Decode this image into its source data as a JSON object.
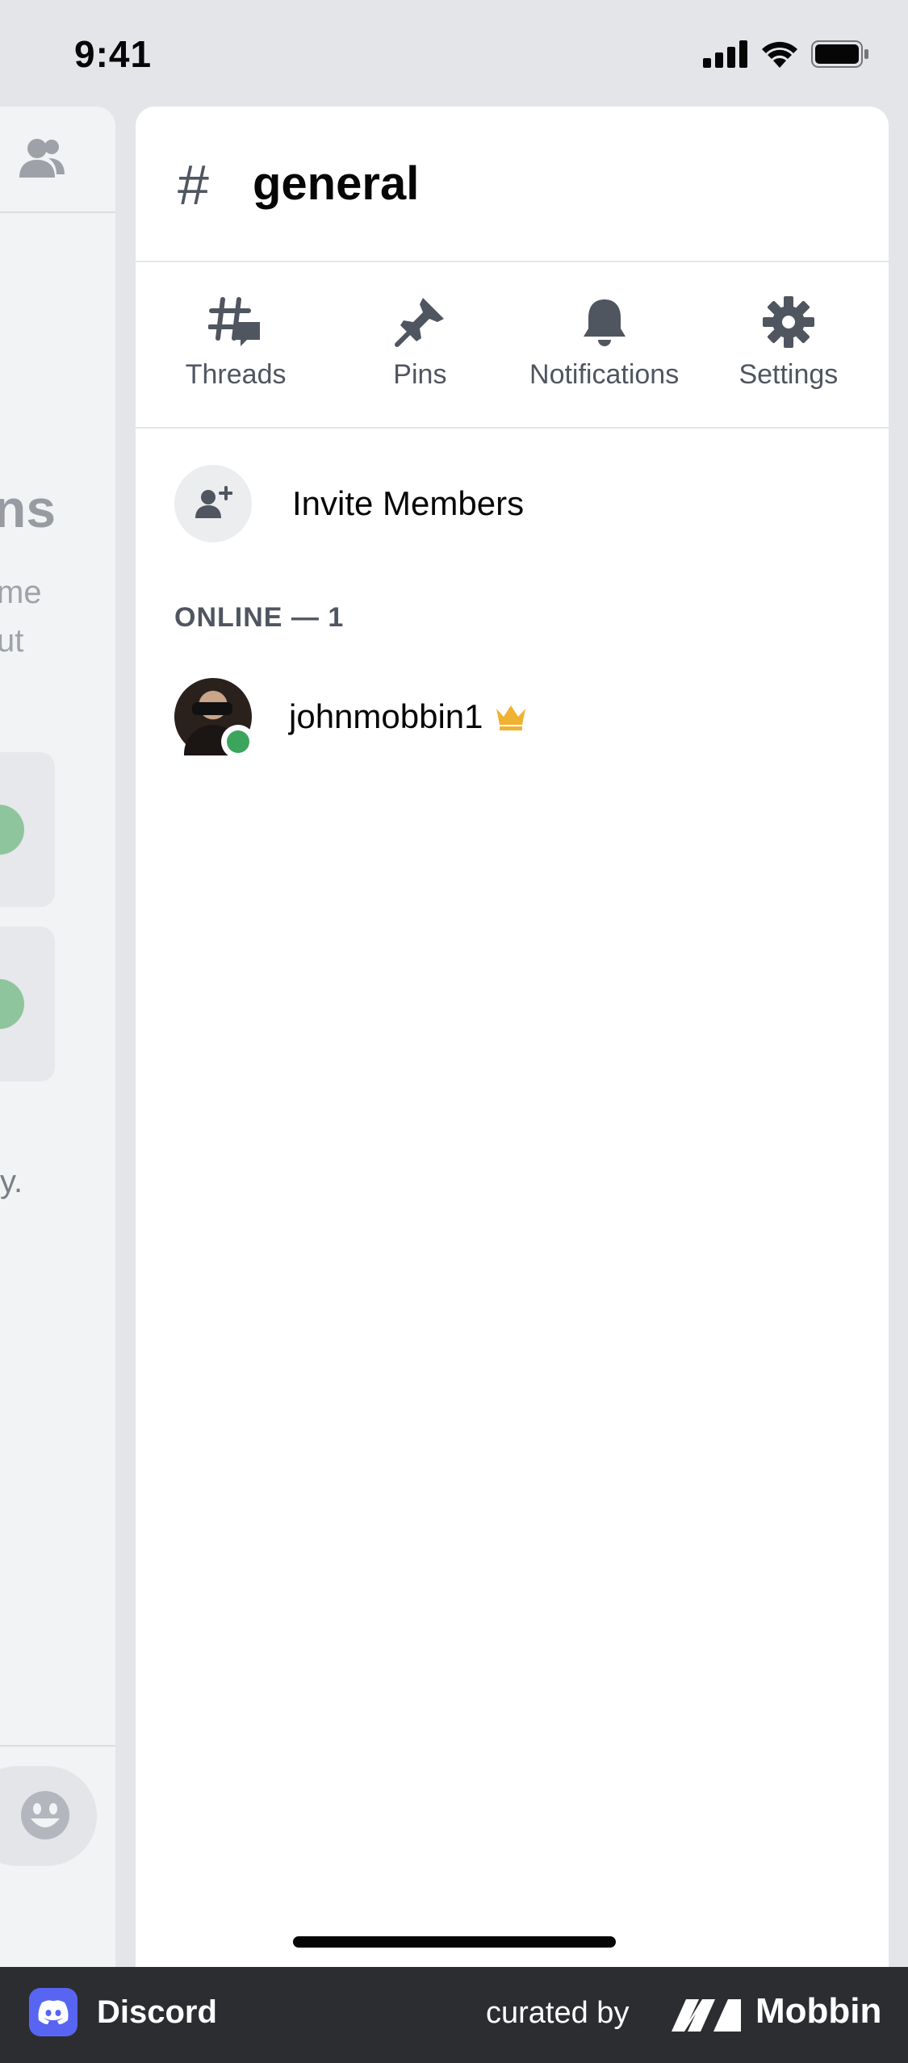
{
  "status_bar": {
    "time": "9:41"
  },
  "background_pane": {
    "heading_fragment": "ns",
    "line1_fragment": "me",
    "line2_fragment": "ut",
    "trailing_fragment": "y."
  },
  "channel": {
    "name": "general"
  },
  "actions": [
    {
      "label": "Threads",
      "icon": "threads-icon"
    },
    {
      "label": "Pins",
      "icon": "pin-icon"
    },
    {
      "label": "Notifications",
      "icon": "bell-icon"
    },
    {
      "label": "Settings",
      "icon": "gear-icon"
    }
  ],
  "invite": {
    "label": "Invite Members"
  },
  "online_section": {
    "header": "ONLINE — 1"
  },
  "members": [
    {
      "name": "johnmobbin1",
      "status": "online",
      "role_icon": "crown-icon"
    }
  ],
  "footer": {
    "app_name": "Discord",
    "curated_by": "curated by",
    "brand": "Mobbin"
  },
  "colors": {
    "online": "#3ba55d",
    "crown": "#f0b232",
    "discord_blurple": "#5865f2",
    "icon_gray": "#4f5660"
  }
}
